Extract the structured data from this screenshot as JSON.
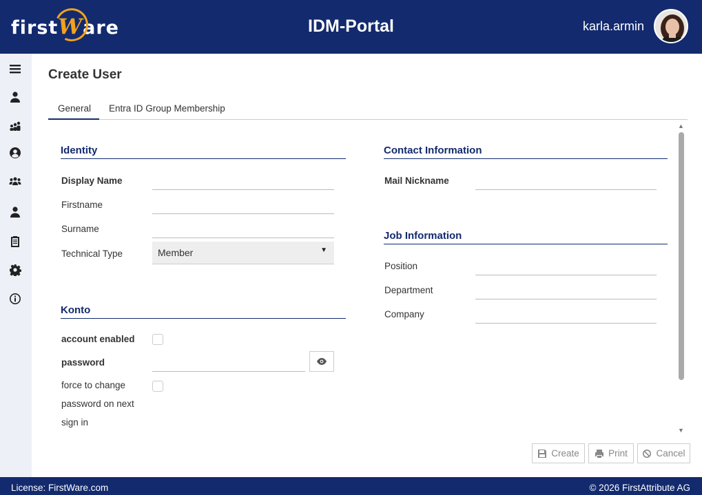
{
  "header": {
    "logo_text_before": "first",
    "logo_text_w": "W",
    "logo_text_after": "are",
    "app_title": "IDM-Portal",
    "username": "karla.armin"
  },
  "sidebar": {
    "icons": [
      "menu-icon",
      "user-icon",
      "group-icon",
      "user-circle-icon",
      "users-icon",
      "person-icon",
      "clipboard-icon",
      "gear-icon",
      "info-icon"
    ]
  },
  "page": {
    "title": "Create User",
    "tabs": [
      {
        "label": "General",
        "active": true
      },
      {
        "label": "Entra ID Group Membership",
        "active": false
      }
    ]
  },
  "identity": {
    "title": "Identity",
    "display_name_label": "Display Name",
    "display_name_value": "",
    "firstname_label": "Firstname",
    "firstname_value": "",
    "surname_label": "Surname",
    "surname_value": "",
    "technical_type_label": "Technical Type",
    "technical_type_value": "Member"
  },
  "konto": {
    "title": "Konto",
    "account_enabled_label": "account enabled",
    "password_label": "password",
    "password_value": "",
    "force_change_label_1": "force to change",
    "force_change_label_2": "password on next",
    "force_change_label_3": "sign in"
  },
  "contact": {
    "title": "Contact Information",
    "mail_nickname_label": "Mail Nickname",
    "mail_nickname_value": ""
  },
  "job": {
    "title": "Job Information",
    "position_label": "Position",
    "position_value": "",
    "department_label": "Department",
    "department_value": "",
    "company_label": "Company",
    "company_value": ""
  },
  "actions": {
    "create_label": "Create",
    "print_label": "Print",
    "cancel_label": "Cancel"
  },
  "footer": {
    "license": "License: FirstWare.com",
    "copyright": "© 2026 FirstAttribute AG"
  },
  "colors": {
    "brand": "#132a6e",
    "accent": "#f0a21d"
  }
}
